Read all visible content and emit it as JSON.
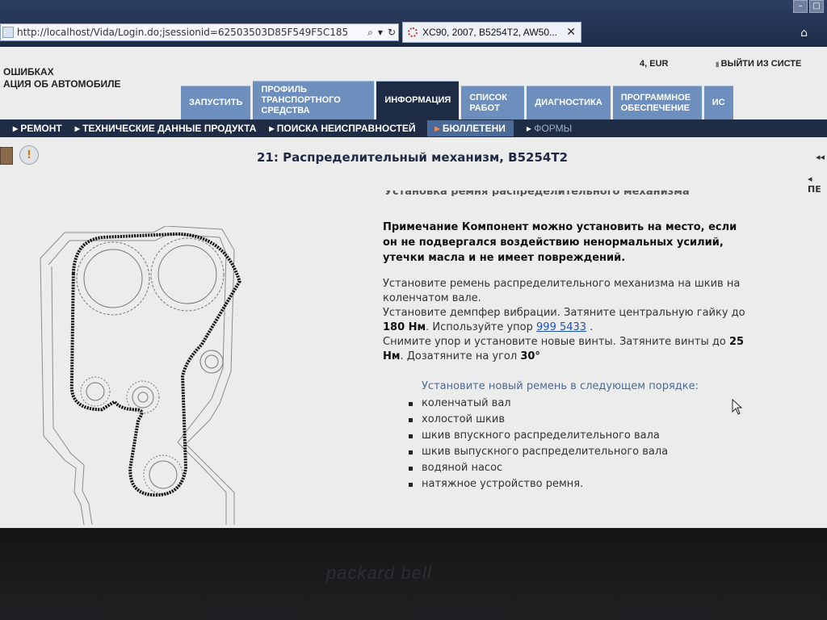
{
  "browser": {
    "url": "http://localhost/Vida/Login.do;jsessionid=62503503D85F549F5C185",
    "search_ctl": "⌕",
    "dropdown_ctl": "▾",
    "refresh_ctl": "↻",
    "tab_title": "XC90, 2007, B5254T2, AW50...",
    "tab_close": "✕",
    "home": "⌂",
    "win_min": "–",
    "win_max": "□"
  },
  "header": {
    "app_title_1": "ОШИБКАХ",
    "app_title_2": "АЦИЯ ОБ АВТОМОБИЛЕ",
    "account": "4, EUR",
    "logout": "ВЫЙТИ ИЗ СИСТЕ"
  },
  "nav_tabs": [
    {
      "label": "ЗАПУСТИТЬ"
    },
    {
      "label": "ПРОФИЛЬ ТРАНСПОРТНОГО СРЕДСТВА"
    },
    {
      "label": "ИНФОРМАЦИЯ"
    },
    {
      "label": "СПИСОК РАБОТ"
    },
    {
      "label": "ДИАГНОСТИКА"
    },
    {
      "label": "ПРОГРАММНОЕ ОБЕСПЕЧЕНИЕ"
    },
    {
      "label": "ИС"
    }
  ],
  "sub_nav": [
    {
      "label": "РЕМОНТ"
    },
    {
      "label": "ТЕХНИЧЕСКИЕ ДАННЫЕ ПРОДУКТА"
    },
    {
      "label": "ПОИСКА НЕИСПРАВНОСТЕЙ"
    },
    {
      "label": "БЮЛЛЕТЕНИ"
    },
    {
      "label": "ФОРМЫ"
    }
  ],
  "document": {
    "title": "21: Распределительный механизм, B5254T2",
    "right_arrows": "◂◂",
    "right_label": "ПЕ",
    "clipped_heading": "Установка ремня распределительного механизма",
    "note": "Примечание Компонент можно установить на место, если он не подвергался воздействию ненормальных усилий, утечки масла и не имеет повреждений.",
    "instr": {
      "line1": "Установите ремень распределительного механизма на шкив на коленчатом вале.",
      "line2a": "Установите демпфер вибрации. Затяните центральную гайку до ",
      "torque1": "180 Нм",
      "line2b": ". Используйте упор ",
      "tool_link": "999 5433",
      "line2c": " .",
      "line3a": "Снимите упор и установите новые винты. Затяните винты до ",
      "torque2": "25 Нм",
      "line3b": ". Дозатяните на угол ",
      "angle": "30°"
    },
    "order_heading": "Установите новый ремень в следующем порядке:",
    "order_items": [
      "коленчатый вал",
      "холостой шкив",
      "шкив впускного распределительного вала",
      "шкив выпускного распределительного вала",
      "водяной насос",
      "натяжное устройство ремня."
    ]
  },
  "bezel": {
    "brand": "packard bell"
  }
}
